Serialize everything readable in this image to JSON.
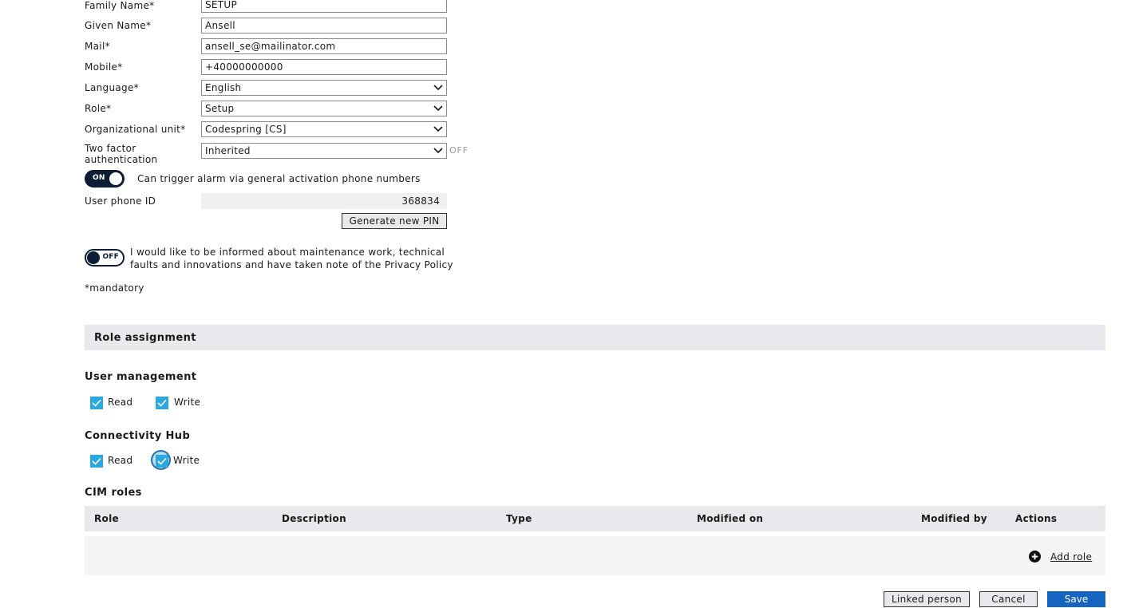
{
  "colors": {
    "accent": "#29a9e0",
    "primary_button": "#1565c0",
    "toggle_dark": "#0b1e33",
    "section_bg": "#e8e9ec"
  },
  "form": {
    "family_name": {
      "label": "Family Name*",
      "value": "SETUP"
    },
    "given_name": {
      "label": "Given Name*",
      "value": "Ansell"
    },
    "mail": {
      "label": "Mail*",
      "value": "ansell_se@mailinator.com"
    },
    "mobile": {
      "label": "Mobile*",
      "value": "+40000000000"
    },
    "language": {
      "label": "Language*",
      "value": "English"
    },
    "role": {
      "label": "Role*",
      "value": "Setup"
    },
    "org_unit": {
      "label": "Organizational unit*",
      "value": "Codespring [CS]"
    },
    "two_factor": {
      "label_line1": "Two factor",
      "label_line2": "authentication",
      "value": "Inherited",
      "status": "OFF"
    },
    "alarm_toggle": {
      "state": "ON",
      "label": "Can trigger alarm via general activation phone numbers"
    },
    "user_phone_id": {
      "label": "User phone ID",
      "value": "368834"
    },
    "generate_pin_label": "Generate new PIN",
    "newsletter_toggle": {
      "state": "OFF",
      "label_line1": "I would like to be informed about maintenance work, technical",
      "label_line2": "faults and innovations and have taken note of the Privacy Policy"
    },
    "mandatory_note": "*mandatory"
  },
  "role_assignment": {
    "title": "Role assignment",
    "user_management": {
      "title": "User management",
      "read_label": "Read",
      "write_label": "Write",
      "read_checked": true,
      "write_checked": true
    },
    "connectivity_hub": {
      "title": "Connectivity Hub",
      "read_label": "Read",
      "write_label": "Write",
      "read_checked": true,
      "write_checked": true
    }
  },
  "cim_roles": {
    "title": "CIM roles",
    "columns": [
      "Role",
      "Description",
      "Type",
      "Modified on",
      "Modified by",
      "Actions"
    ],
    "add_role_label": "Add role",
    "add_icon": "plus-circle-icon"
  },
  "footer": {
    "linked_person_label": "Linked person",
    "cancel_label": "Cancel",
    "save_label": "Save"
  }
}
